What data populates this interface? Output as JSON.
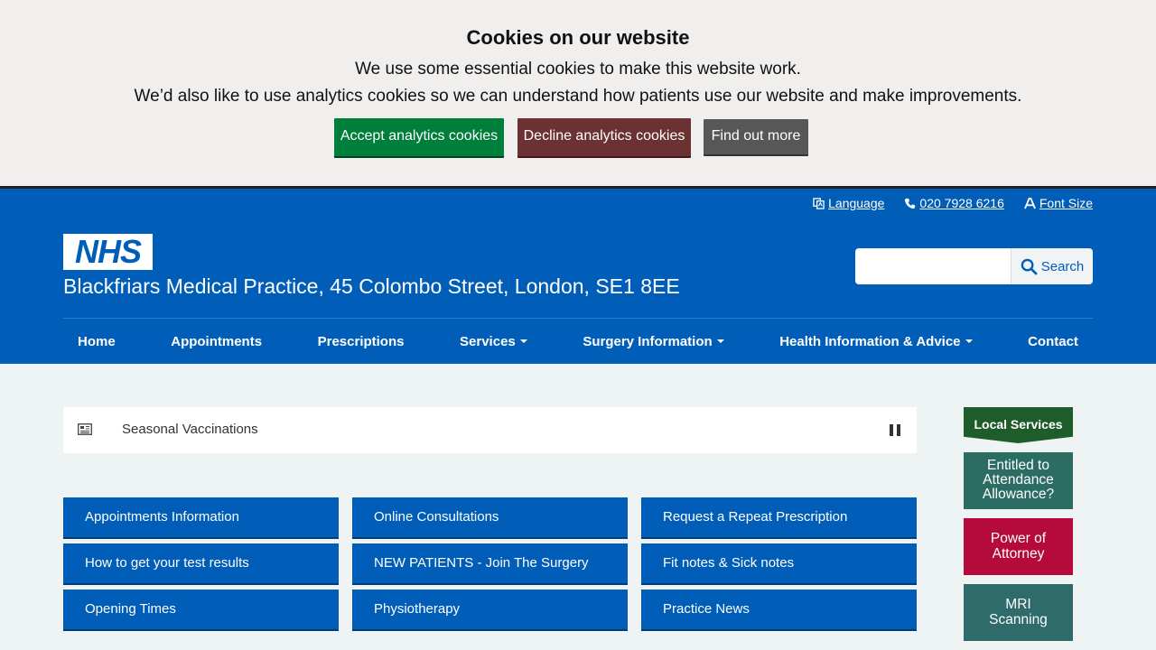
{
  "cookie_banner": {
    "title": "Cookies on our website",
    "line1": "We use some essential cookies to make this website work.",
    "line2": "We’d also like to use analytics cookies so we can understand how patients use our website and make improvements.",
    "accept_label": "Accept analytics cookies",
    "decline_label": "Decline analytics cookies",
    "more_label": "Find out more"
  },
  "utility": {
    "language": "Language",
    "phone": "020 7928 6216",
    "font_size": "Font Size"
  },
  "header": {
    "logo_text": "NHS",
    "practice_name": "Blackfriars Medical Practice, 45 Colombo Street, London, SE1 8EE",
    "search_placeholder": "",
    "search_label": "Search"
  },
  "nav": {
    "items": [
      {
        "label": "Home"
      },
      {
        "label": "Appointments"
      },
      {
        "label": "Prescriptions"
      },
      {
        "label": "Services"
      },
      {
        "label": "Surgery Information"
      },
      {
        "label": "Health Information & Advice"
      },
      {
        "label": "Contact"
      }
    ]
  },
  "ticker": {
    "text": "Seasonal Vaccinations"
  },
  "tiles": [
    "Appointments Information",
    "Online Consultations",
    "Request a Repeat Prescription",
    "How to get your test results",
    "NEW PATIENTS - Join The Surgery",
    "Fit notes & Sick notes",
    "Opening Times",
    "Physiotherapy",
    "Practice News"
  ],
  "sidebar": {
    "local_services": "Local Services",
    "attendance_line1": "Entitled to",
    "attendance_line2": "Attendance",
    "attendance_line3": "Allowance?",
    "power_line1": "Power of",
    "power_line2": "Attorney",
    "mri_line1": "MRI",
    "mri_line2": "Scanning"
  },
  "colors": {
    "nhs_blue": "#005eb8",
    "accept_green": "#007f3b",
    "decline_red": "#6b3133",
    "more_grey": "#575757"
  }
}
